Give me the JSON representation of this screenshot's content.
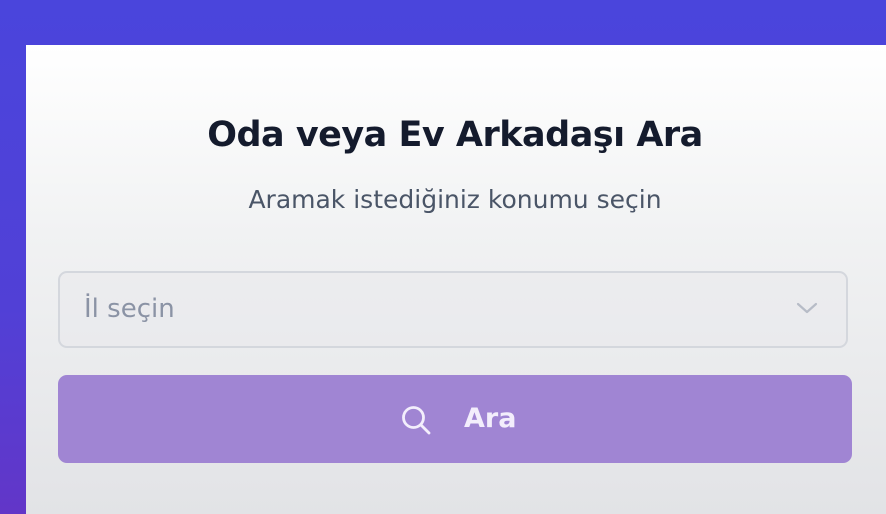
{
  "page": {
    "title": "Oda veya Ev Arkadaşı Ara",
    "subtitle": "Aramak istediğiniz konumu seçin"
  },
  "location_select": {
    "placeholder": "İl seçin",
    "icon": "chevron-down-icon"
  },
  "search_button": {
    "label": "Ara",
    "icon": "search-icon",
    "disabled": true
  },
  "colors": {
    "background": "#4a45dc",
    "card": "#f3f4f5",
    "title": "#141b2d",
    "subtitle": "#4a5567",
    "placeholder": "#8b93a5",
    "button": "#a085d3",
    "button_text": "#f3eefc"
  }
}
